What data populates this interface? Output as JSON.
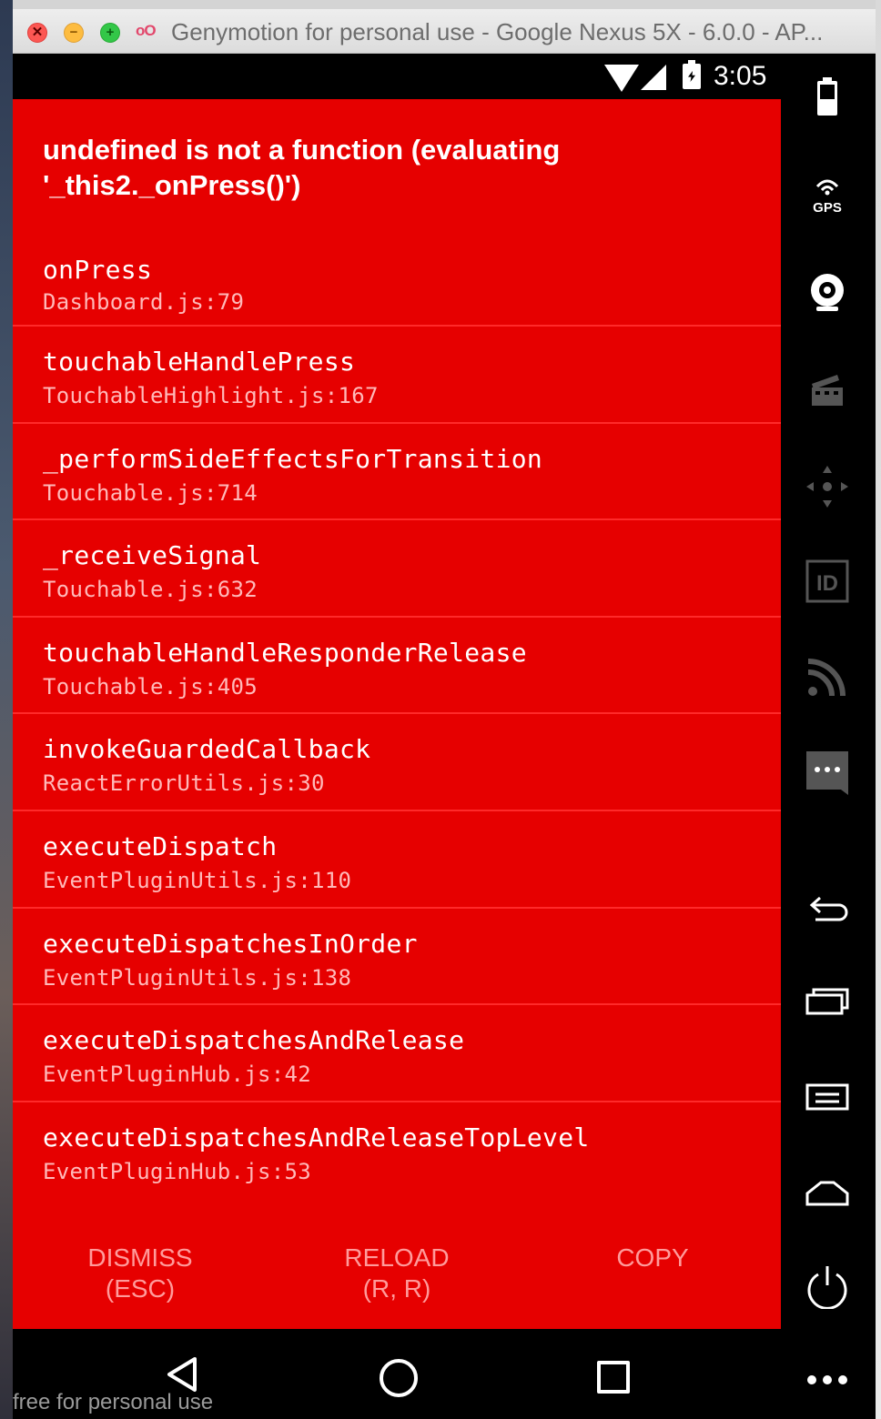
{
  "window": {
    "title": "Genymotion for personal use - Google Nexus 5X - 6.0.0 - AP...",
    "controls": {
      "close": "✕",
      "minimize": "−",
      "maximize": "+"
    },
    "app_logo": "oO"
  },
  "statusbar": {
    "time": "3:05"
  },
  "error": {
    "message": "undefined is not a function (evaluating '_this2._onPress()')",
    "frames": [
      {
        "fn": "onPress",
        "file": "Dashboard.js:79"
      },
      {
        "fn": "touchableHandlePress",
        "file": "TouchableHighlight.js:167"
      },
      {
        "fn": "_performSideEffectsForTransition",
        "file": "Touchable.js:714"
      },
      {
        "fn": "_receiveSignal",
        "file": "Touchable.js:632"
      },
      {
        "fn": "touchableHandleResponderRelease",
        "file": "Touchable.js:405"
      },
      {
        "fn": "invokeGuardedCallback",
        "file": "ReactErrorUtils.js:30"
      },
      {
        "fn": "executeDispatch",
        "file": "EventPluginUtils.js:110"
      },
      {
        "fn": "executeDispatchesInOrder",
        "file": "EventPluginUtils.js:138"
      },
      {
        "fn": "executeDispatchesAndRelease",
        "file": "EventPluginHub.js:42"
      },
      {
        "fn": "executeDispatchesAndReleaseTopLevel",
        "file": "EventPluginHub.js:53"
      }
    ],
    "buttons": {
      "dismiss_line1": "DISMISS",
      "dismiss_line2": "(ESC)",
      "reload_line1": "RELOAD",
      "reload_line2": "(R, R)",
      "copy": "COPY"
    }
  },
  "watermark": "free for personal use",
  "sidebar": {
    "gps_label": "GPS",
    "id_label": "ID",
    "icons": [
      "battery-icon",
      "gps-icon",
      "webcam-icon",
      "capture-icon",
      "dpad-icon",
      "identifiers-icon",
      "cast-icon",
      "sms-icon",
      "back-icon",
      "recent-apps-icon",
      "menu-icon",
      "home-icon",
      "power-icon",
      "more-icon"
    ]
  },
  "colors": {
    "error_background": "#e60000",
    "file_text": "#ffb9b9",
    "button_text": "#ff9b9b"
  }
}
